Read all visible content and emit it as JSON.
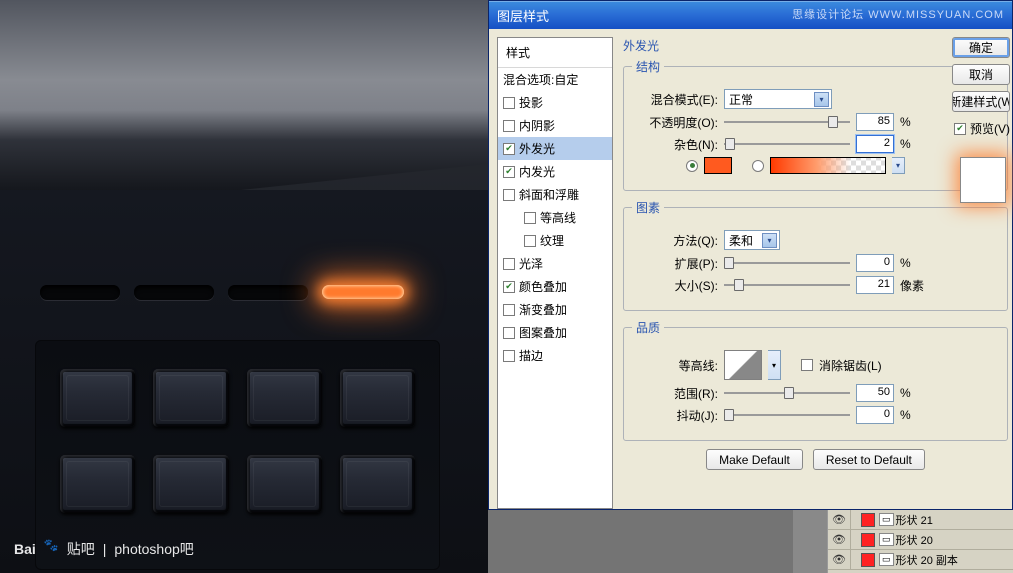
{
  "titlebar": "图层样式",
  "watermark_top": "思缘设计论坛  WWW.MISSYUAN.COM",
  "styles": {
    "header": "样式",
    "blend": "混合选项:自定",
    "items": [
      {
        "label": "投影",
        "checked": false
      },
      {
        "label": "内阴影",
        "checked": false
      },
      {
        "label": "外发光",
        "checked": true,
        "selected": true
      },
      {
        "label": "内发光",
        "checked": true
      },
      {
        "label": "斜面和浮雕",
        "checked": false
      },
      {
        "label": "等高线",
        "checked": false,
        "indent": true
      },
      {
        "label": "纹理",
        "checked": false,
        "indent": true
      },
      {
        "label": "光泽",
        "checked": false
      },
      {
        "label": "颜色叠加",
        "checked": true
      },
      {
        "label": "渐变叠加",
        "checked": false
      },
      {
        "label": "图案叠加",
        "checked": false
      },
      {
        "label": "描边",
        "checked": false
      }
    ]
  },
  "panel_title": "外发光",
  "structure": {
    "legend": "结构",
    "blend_mode_label": "混合模式(E):",
    "blend_mode_value": "正常",
    "opacity_label": "不透明度(O):",
    "opacity_value": "85",
    "noise_label": "杂色(N):",
    "noise_value": "2",
    "pct": "%"
  },
  "elements": {
    "legend": "图素",
    "technique_label": "方法(Q):",
    "technique_value": "柔和",
    "spread_label": "扩展(P):",
    "spread_value": "0",
    "size_label": "大小(S):",
    "size_value": "21",
    "px": "像素",
    "pct": "%"
  },
  "quality": {
    "legend": "品质",
    "contour_label": "等高线:",
    "antialias_label": "消除锯齿(L)",
    "range_label": "范围(R):",
    "range_value": "50",
    "jitter_label": "抖动(J):",
    "jitter_value": "0",
    "pct": "%"
  },
  "buttons": {
    "make_default": "Make Default",
    "reset_default": "Reset to Default",
    "ok": "确定",
    "cancel": "取消",
    "new_style": "新建样式(W",
    "preview": "预览(V)"
  },
  "layers": {
    "row1": "形状 21",
    "row2": "形状 20",
    "row3": "形状 20 副本"
  },
  "footer": {
    "brand": "Bai",
    "brand2": "贴吧",
    "sep": "|",
    "text": "photoshop吧"
  },
  "chart_data": null
}
